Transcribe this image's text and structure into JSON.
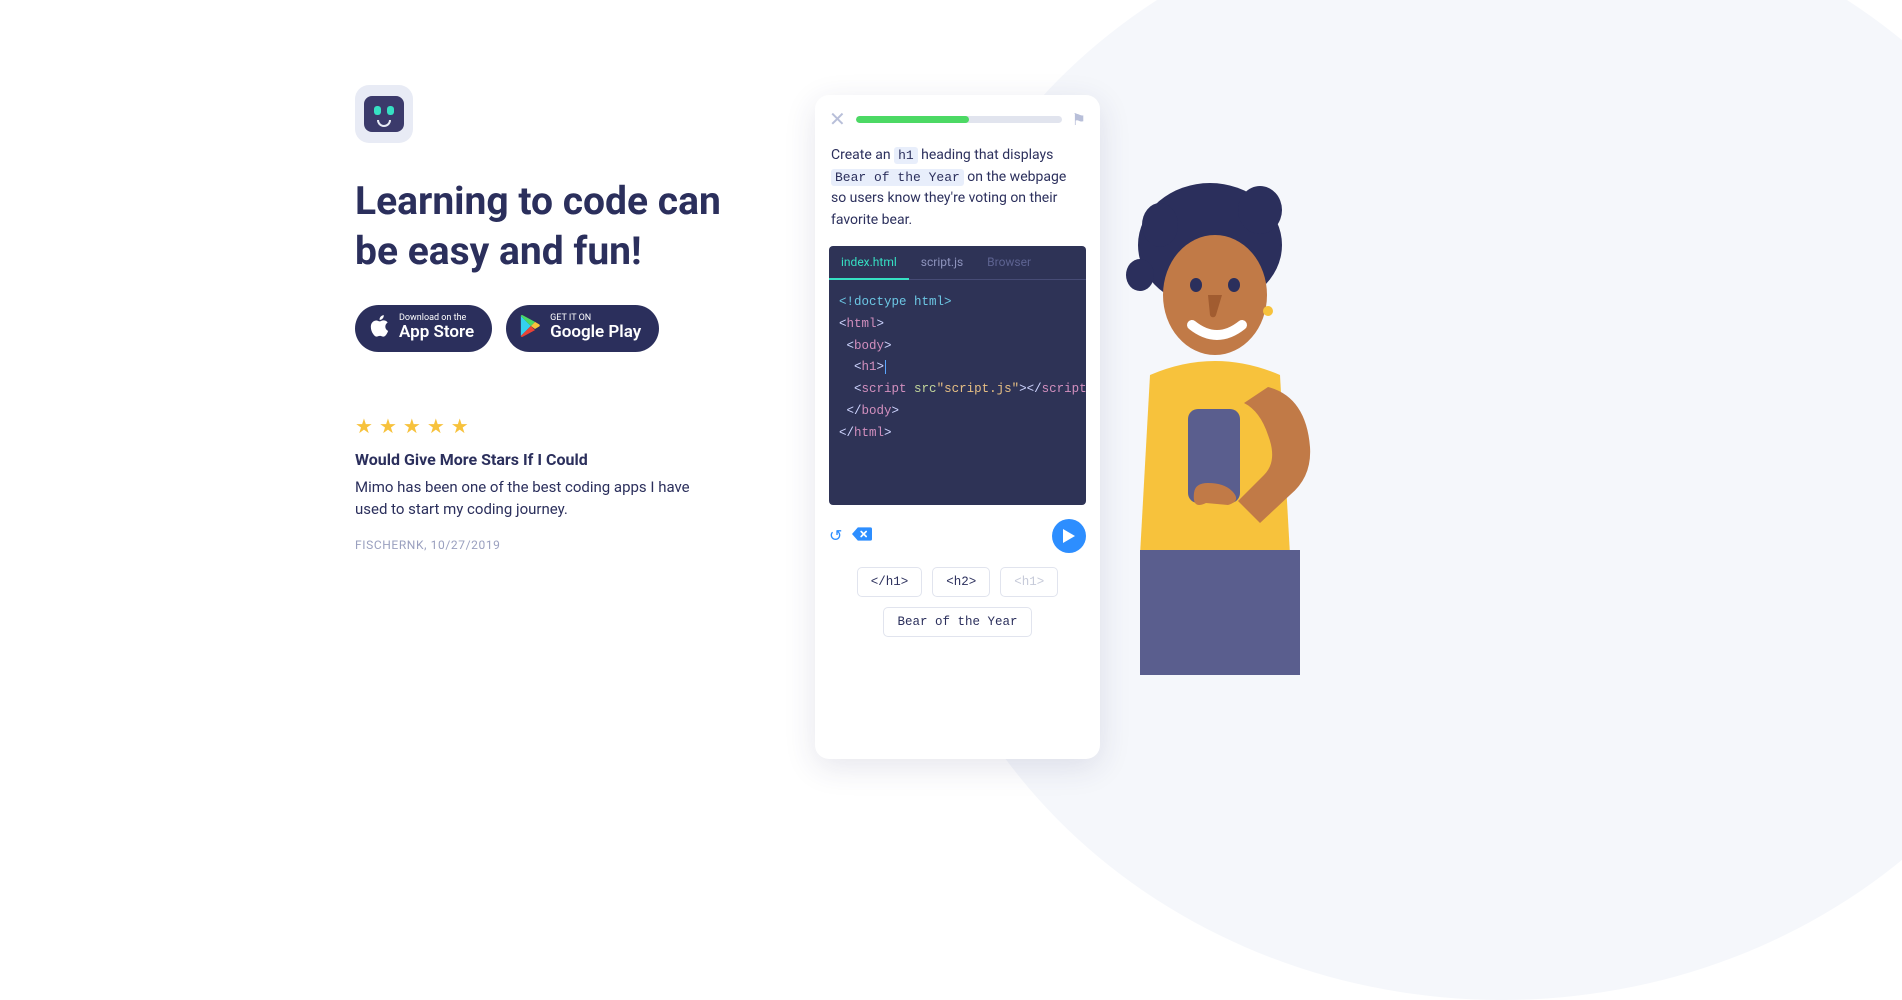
{
  "hero": {
    "headline": "Learning to code can be easy and fun!"
  },
  "stores": {
    "apple": {
      "line1": "Download on the",
      "line2": "App Store"
    },
    "google": {
      "line1": "GET IT ON",
      "line2": "Google Play"
    }
  },
  "review": {
    "stars": 5,
    "title": "Would Give More Stars If I Could",
    "body": "Mimo has been one of the best coding apps I have used to start my coding journey.",
    "author": "FISCHERNK",
    "date": "10/27/2019"
  },
  "phone": {
    "progress_pct": 55,
    "prompt": {
      "t1": "Create an ",
      "c1": "h1",
      "t2": " heading that displays ",
      "c2": "Bear of the Year",
      "t3": " on the webpage so users know they're voting on their favorite bear."
    },
    "tabs": {
      "a": "index.html",
      "b": "script.js",
      "c": "Browser"
    },
    "code": {
      "l1a": "<!doctype ",
      "l1b": "html",
      "l1c": ">",
      "l2": "<html>",
      "l3": "<body>",
      "l4": "<h1>",
      "l5a": "<script ",
      "l5b": "src",
      "l5c": "\"script.js\"",
      "l5d": "></",
      "l5e": "script",
      "l5f": ">",
      "l6": "</body>",
      "l7": "</html>"
    },
    "tokens": {
      "a": "</h1>",
      "b": "<h2>",
      "c": "<h1>",
      "d": "Bear of the Year"
    }
  }
}
